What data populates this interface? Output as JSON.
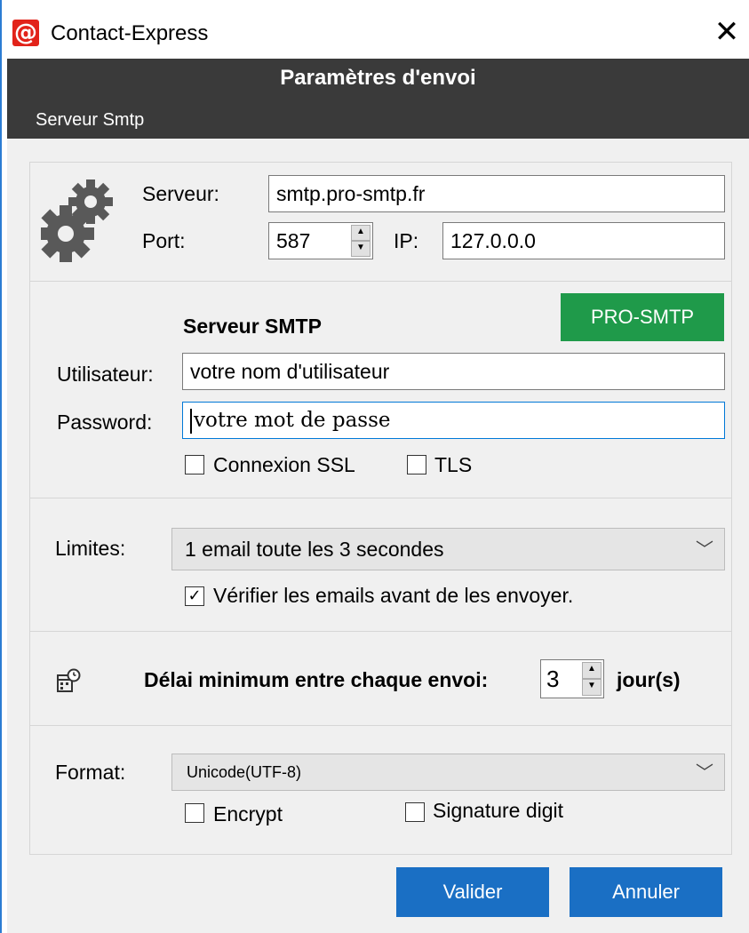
{
  "titlebar": {
    "app_icon_glyph": "@",
    "title": "Contact-Express",
    "close_glyph": "✕"
  },
  "header": {
    "title": "Paramètres d'envoi",
    "subtitle": "Serveur Smtp"
  },
  "server": {
    "host_label": "Serveur:",
    "host_value": "smtp.pro-smtp.fr",
    "port_label": "Port:",
    "port_value": "587",
    "ip_label": "IP:",
    "ip_value": "127.0.0.0"
  },
  "smtp": {
    "heading": "Serveur SMTP",
    "pro_button": "PRO-SMTP",
    "user_label": "Utilisateur:",
    "user_value": "votre nom d'utilisateur",
    "password_label": "Password:",
    "password_value": "votre mot de passe",
    "ssl_label": "Connexion SSL",
    "ssl_checked": false,
    "tls_label": "TLS",
    "tls_checked": false
  },
  "limits": {
    "label": "Limites:",
    "selected": "1 email toute les 3 secondes",
    "verify_label": "Vérifier les emails avant de les envoyer.",
    "verify_mark": "✓"
  },
  "delay": {
    "label": "Délai minimum entre chaque envoi:",
    "value": "3",
    "unit": "jour(s)"
  },
  "format": {
    "label": "Format:",
    "selected": "Unicode(UTF-8)",
    "encrypt_label": "Encrypt",
    "signature_label": "Signature digit"
  },
  "buttons": {
    "ok": "Valider",
    "cancel": "Annuler"
  },
  "icons": {
    "gear": "gear-icon",
    "calendar": "calendar-icon",
    "spin_up": "▲",
    "spin_down": "▼",
    "chevron": "﹀"
  },
  "colors": {
    "header_bg": "#3a3a3a",
    "pro_button": "#1f9a4a",
    "primary_button": "#1a6fc4",
    "focus_border": "#0078d7",
    "app_icon": "#e2231a"
  }
}
